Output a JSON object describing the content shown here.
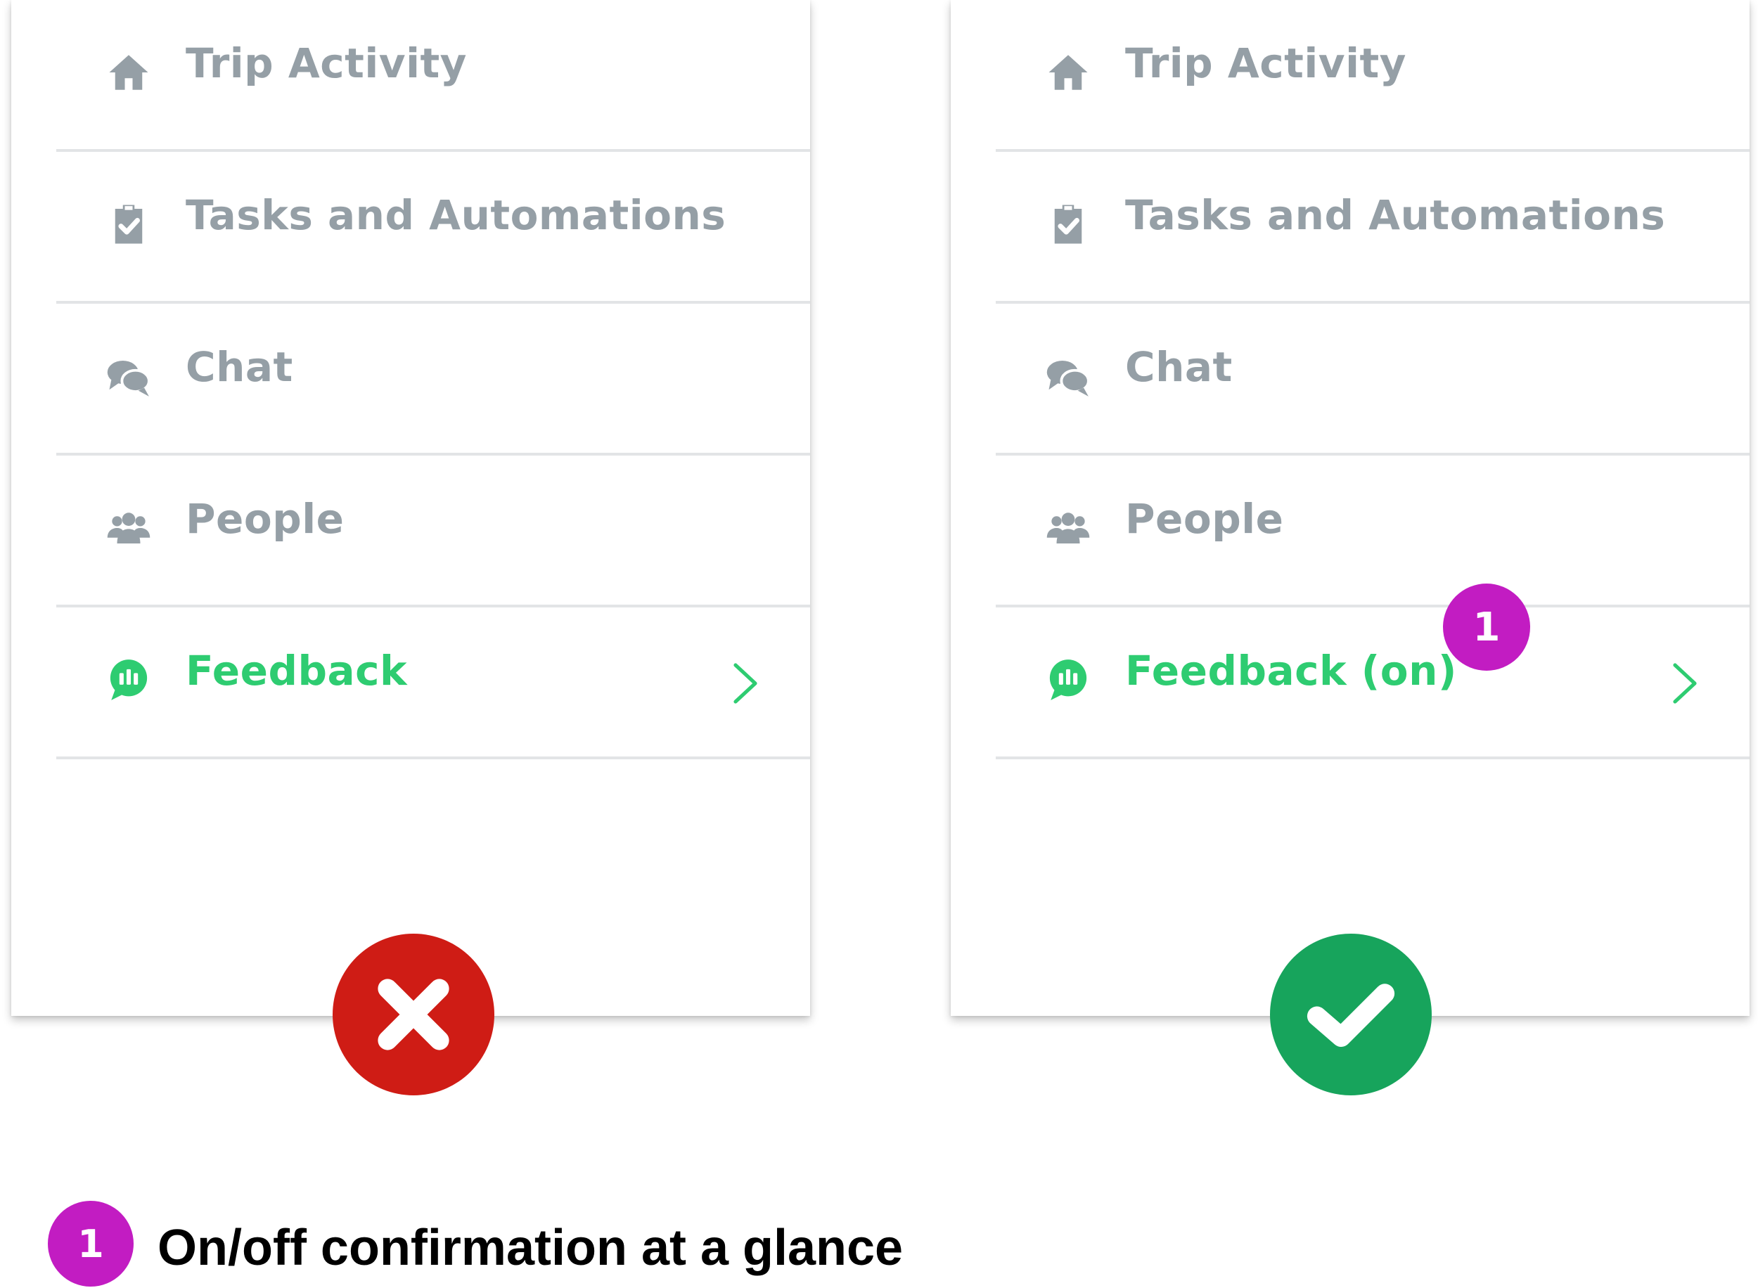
{
  "panels": [
    {
      "variant": "bad",
      "menu": [
        {
          "icon": "home-icon",
          "label": "Trip Activity"
        },
        {
          "icon": "clipboard-check-icon",
          "label": "Tasks and Automations"
        },
        {
          "icon": "chat-bubbles-icon",
          "label": "Chat"
        },
        {
          "icon": "people-icon",
          "label": "People"
        },
        {
          "icon": "feedback-icon",
          "label": "Feedback",
          "chevron": "chevron-right-icon"
        }
      ],
      "verdict_icon": "x-icon",
      "verdict_color": "#cf1c15"
    },
    {
      "variant": "good",
      "menu": [
        {
          "icon": "home-icon",
          "label": "Trip Activity"
        },
        {
          "icon": "clipboard-check-icon",
          "label": "Tasks and Automations"
        },
        {
          "icon": "chat-bubbles-icon",
          "label": "Chat"
        },
        {
          "icon": "people-icon",
          "label": "People"
        },
        {
          "icon": "feedback-icon",
          "label": "Feedback (on)",
          "chevron": "chevron-right-icon",
          "badge": "1"
        }
      ],
      "verdict_icon": "check-icon",
      "verdict_color": "#17a45c"
    }
  ],
  "legend": {
    "badge": "1",
    "text": "On/off confirmation at a glance"
  },
  "colors": {
    "menu_text": "#959fa6",
    "active_text": "#2ecc71",
    "badge": "#c21cc2",
    "divider": "#e2e4e6"
  }
}
